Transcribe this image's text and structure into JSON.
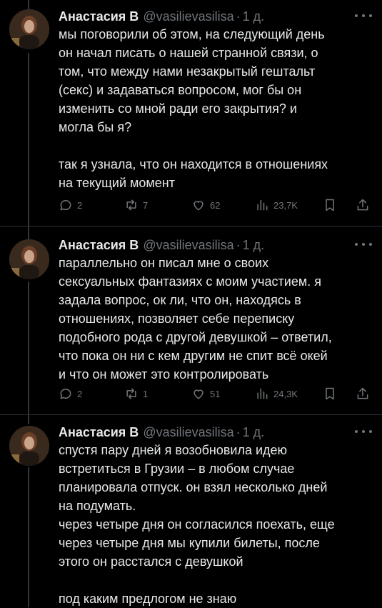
{
  "tweets": [
    {
      "name": "Анастасия В",
      "handle": "@vasilievasilisa",
      "time": "1 д.",
      "lines": [
        "мы поговорили об этом, на следующий день",
        "он начал писать о нашей странной связи, о",
        "том, что между нами незакрытый гештальт",
        "(секс) и задаваться вопросом, мог бы он",
        "изменить со мной ради его закрытия? и",
        "могла бы я?",
        "",
        "так я узнала, что он находится в отношениях",
        "на текущий момент"
      ],
      "replies": "2",
      "reposts": "7",
      "likes": "62",
      "views": "23,7K"
    },
    {
      "name": "Анастасия В",
      "handle": "@vasilievasilisa",
      "time": "1 д.",
      "lines": [
        "параллельно он писал мне о своих",
        "сексуальных фантазиях с моим участием. я",
        "задала вопрос, ок ли, что он, находясь в",
        "отношениях, позволяет себе переписку",
        "подобного рода с другой девушкой – ответил,",
        "что пока он ни с кем другим не спит всё окей",
        "и что он может это контролировать"
      ],
      "replies": "2",
      "reposts": "1",
      "likes": "51",
      "views": "24,3K"
    },
    {
      "name": "Анастасия В",
      "handle": "@vasilievasilisa",
      "time": "1 д.",
      "lines": [
        "спустя пару дней я возобновила идею",
        "встретиться в Грузии – в любом случае",
        "планировала отпуск. он взял несколько дней",
        "на подумать.",
        "через четыре дня он согласился поехать, еще",
        "через четыре дня мы купили билеты, после",
        "этого он расстался с девушкой",
        "",
        "под каким предлогом не знаю"
      ]
    }
  ],
  "icons": [
    "reply-icon",
    "repost-icon",
    "like-icon",
    "views-icon",
    "bookmark-icon",
    "share-icon",
    "more-icon"
  ],
  "colors": {
    "background": "#000000",
    "text": "#e7e9ea",
    "muted": "#71767b",
    "separator": "#2f3336"
  }
}
